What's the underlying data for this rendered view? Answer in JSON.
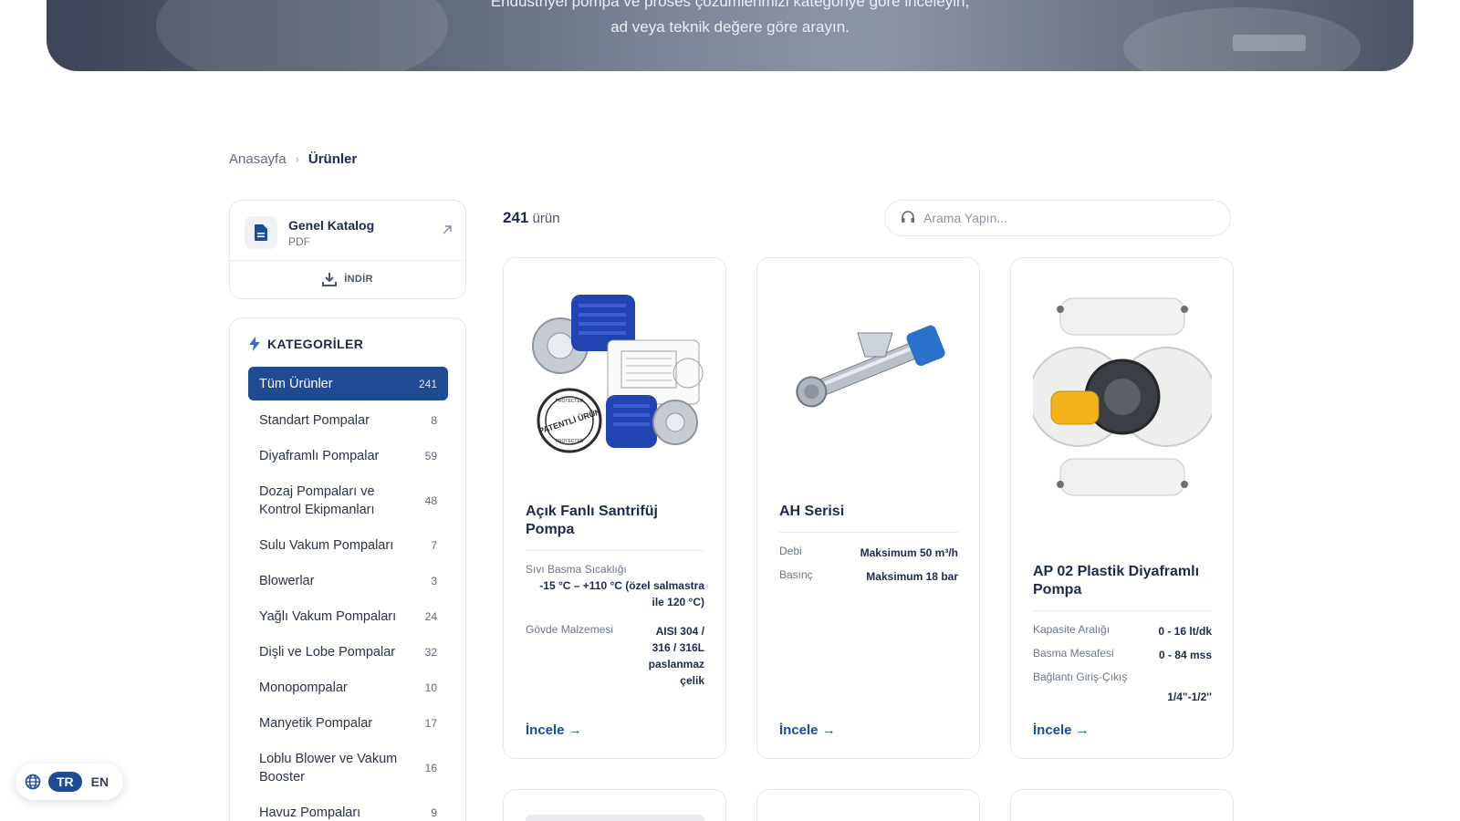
{
  "hero": {
    "line1": "Endüstriyel pompa ve proses çözümlerimizi kategoriye göre inceleyin,",
    "line2": "ad veya teknik değere göre arayın."
  },
  "breadcrumb": {
    "home": "Anasayfa",
    "current": "Ürünler"
  },
  "catalog": {
    "title": "Genel Katalog",
    "format": "PDF",
    "download_label": "İNDİR"
  },
  "categories": {
    "heading": "KATEGORİLER",
    "items": [
      {
        "label": "Tüm Ürünler",
        "count": "241",
        "active": true
      },
      {
        "label": "Standart Pompalar",
        "count": "8"
      },
      {
        "label": "Diyaframlı Pompalar",
        "count": "59"
      },
      {
        "label": "Dozaj Pompaları ve Kontrol Ekipmanları",
        "count": "48"
      },
      {
        "label": "Sulu Vakum Pompaları",
        "count": "7"
      },
      {
        "label": "Blowerlar",
        "count": "3"
      },
      {
        "label": "Yağlı Vakum Pompaları",
        "count": "24"
      },
      {
        "label": "Dişli ve Lobe Pompalar",
        "count": "32"
      },
      {
        "label": "Monopompalar",
        "count": "10"
      },
      {
        "label": "Manyetik Pompalar",
        "count": "17"
      },
      {
        "label": "Loblu Blower ve Vakum Booster",
        "count": "16"
      },
      {
        "label": "Havuz Pompaları",
        "count": "9"
      }
    ]
  },
  "results": {
    "count": "241",
    "unit": "ürün"
  },
  "search": {
    "placeholder": "Arama Yapın..."
  },
  "products": [
    {
      "title": "Açık Fanlı Santrifüj Pompa",
      "badge": "PATENTLİ ÜRÜN",
      "badge_ring": "PROTECTED",
      "specs": [
        {
          "label": "Sıvı Basma Sıcaklığı",
          "value": "-15 °C – +110 °C (özel salmastra ile 120 °C)"
        },
        {
          "label": "Gövde Malzemesi",
          "value": "AISI 304 / 316 / 316L paslanmaz çelik"
        }
      ],
      "link": "İncele →"
    },
    {
      "title": "AH Serisi",
      "specs": [
        {
          "label": "Debi",
          "value": "Maksimum 50 m³/h"
        },
        {
          "label": "Basınç",
          "value": "Maksimum 18 bar"
        }
      ],
      "link": "İncele →"
    },
    {
      "title": "AP 02 Plastik Diyaframlı Pompa",
      "specs": [
        {
          "label": "Kapasite Aralığı",
          "value": "0 - 16 lt/dk"
        },
        {
          "label": "Basma Mesafesi",
          "value": "0 - 84 mss"
        },
        {
          "label": "Bağlantı Giriş-Çıkış",
          "value": "1/4\"-1/2''"
        }
      ],
      "link": "İncele →"
    }
  ],
  "language": {
    "active": "TR",
    "other": "EN"
  },
  "colors": {
    "primary": "#1f4a94",
    "text": "#1d2a4d",
    "border": "#e4e7ec"
  }
}
